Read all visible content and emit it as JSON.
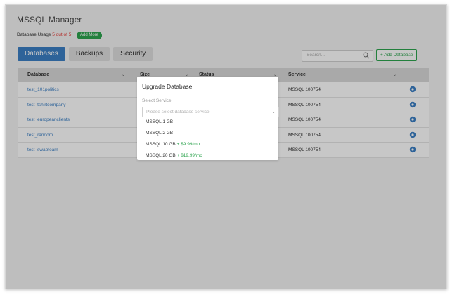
{
  "app": {
    "title": "MSSQL Manager"
  },
  "usage": {
    "label": "Database Usage",
    "count": "5 out of 5",
    "add_more": "Add More"
  },
  "tabs": [
    {
      "label": "Databases",
      "active": true
    },
    {
      "label": "Backups",
      "active": false
    },
    {
      "label": "Security",
      "active": false
    }
  ],
  "search": {
    "placeholder": "Search..."
  },
  "add_database": {
    "label": "+ Add Database"
  },
  "table": {
    "headers": {
      "database": "Database",
      "size": "Size",
      "status": "Status",
      "service": "Service"
    },
    "rows": [
      {
        "database": "test_101politics",
        "service": "MSSQL 100754"
      },
      {
        "database": "test_tshirtcompany",
        "service": "MSSQL 100754"
      },
      {
        "database": "test_europeanclients",
        "service": "MSSQL 100754"
      },
      {
        "database": "test_random",
        "service": "MSSQL 100754"
      },
      {
        "database": "test_swapteam",
        "service": "MSSQL 100754"
      }
    ]
  },
  "modal": {
    "title": "Upgrade Database",
    "field_label": "Select Service",
    "select_placeholder": "Please select database service",
    "options": [
      {
        "label": "MSSQL 1 GB",
        "price": ""
      },
      {
        "label": "MSSQL 2 GB",
        "price": ""
      },
      {
        "label": "MSSQL 10 GB",
        "price": "+ $9.99/mo"
      },
      {
        "label": "MSSQL 20 GB",
        "price": "+ $19.99/mo"
      }
    ]
  },
  "colors": {
    "accent": "#3b7fc4",
    "success": "#2ea44f",
    "danger": "#e53935"
  },
  "icons": {
    "search": "search-icon",
    "gear": "gear-icon",
    "chevron": "chevron-down-icon"
  }
}
